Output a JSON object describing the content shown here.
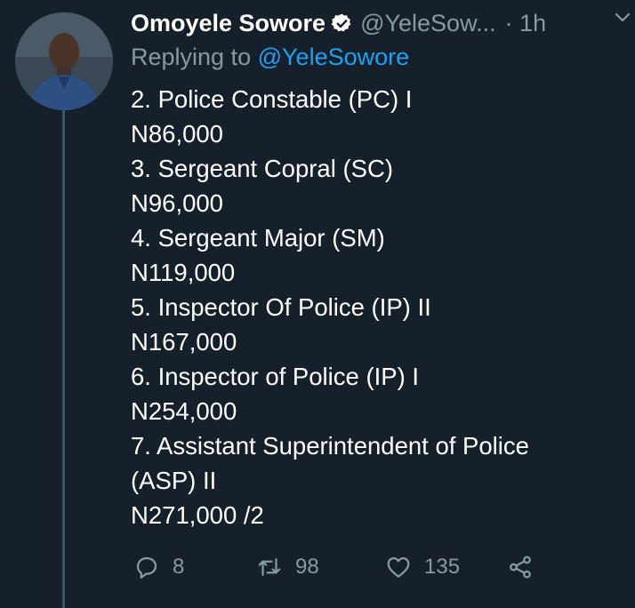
{
  "tweet": {
    "author_name": "Omoyele Sowore",
    "handle": "@YeleSow...",
    "time": "· 1h",
    "replying_prefix": "Replying to",
    "replying_to": "@YeleSowore",
    "lines": [
      "2. Police Constable (PC) I",
      "N86,000",
      "3. Sergeant Copral (SC)",
      "N96,000",
      "4. Sergeant Major (SM)",
      "N119,000",
      "5. Inspector Of Police (IP) II",
      "N167,000",
      "6. Inspector of Police (IP) I",
      "N254,000",
      "7. Assistant Superintendent of Police",
      "(ASP) II",
      "N271,000 /2"
    ],
    "reply_count": "8",
    "retweet_count": "98",
    "like_count": "135"
  },
  "icons": {
    "verified": "verified-badge-icon",
    "menu": "chevron-down-icon",
    "reply": "reply-icon",
    "retweet": "retweet-icon",
    "like": "heart-icon",
    "share": "share-icon"
  },
  "colors": {
    "background": "#15202b",
    "accent": "#1da1f2",
    "muted": "#8899a6",
    "thread_line": "#3d5466"
  }
}
